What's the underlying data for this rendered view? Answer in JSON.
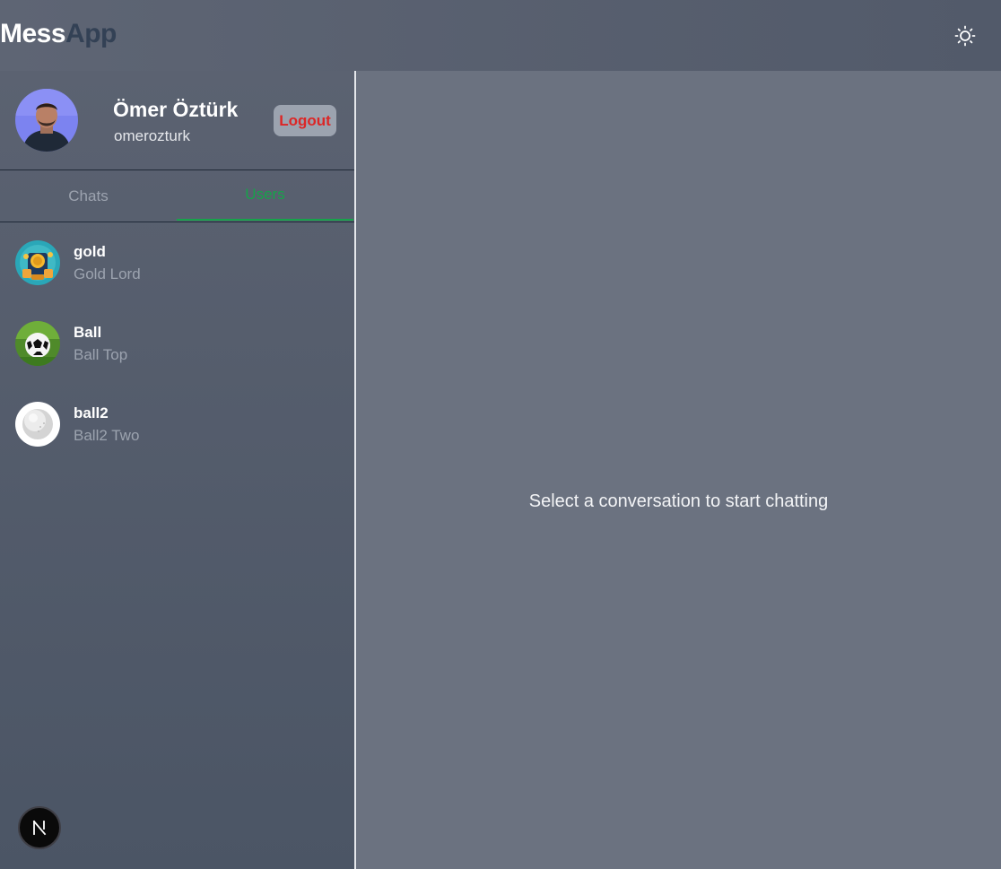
{
  "header": {
    "brand_part1": "Mess",
    "brand_part2": "App",
    "theme_icon": "sun-icon"
  },
  "profile": {
    "name": "Ömer Öztürk",
    "username": "omerozturk",
    "logout_label": "Logout",
    "avatar": "user-photo-avatar"
  },
  "tabs": [
    {
      "label": "Chats",
      "active": false
    },
    {
      "label": "Users",
      "active": true
    }
  ],
  "users": [
    {
      "name": "gold",
      "full_name": "Gold Lord",
      "avatar": "gold-coins-avatar"
    },
    {
      "name": "Ball",
      "full_name": "Ball Top",
      "avatar": "soccer-ball-avatar"
    },
    {
      "name": "ball2",
      "full_name": "Ball2 Two",
      "avatar": "white-ball-avatar"
    }
  ],
  "main": {
    "empty_message": "Select a conversation to start chatting"
  },
  "dev_badge": {
    "letter": "N"
  },
  "colors": {
    "accent_green": "#16a34a",
    "logout_red": "#dc2626",
    "brand_dark": "#334155"
  }
}
